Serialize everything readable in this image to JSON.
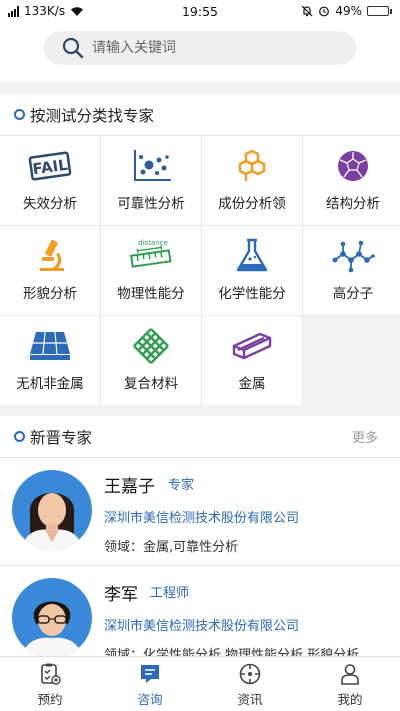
{
  "status_bar": {
    "speed": "133K/s",
    "time": "19:55",
    "battery": "49%",
    "battery_level": 0.49
  },
  "search": {
    "placeholder": "请输入关键词"
  },
  "categories": {
    "title": "按测试分类找专家",
    "items": [
      {
        "label": "失效分析",
        "icon": "fail-stamp-icon"
      },
      {
        "label": "可靠性分析",
        "icon": "scatter-chart-icon"
      },
      {
        "label": "成份分析领",
        "icon": "molecule-hexagon-icon"
      },
      {
        "label": "结构分析",
        "icon": "fullerene-icon"
      },
      {
        "label": "形貌分析",
        "icon": "microscope-icon"
      },
      {
        "label": "物理性能分",
        "icon": "distance-ruler-icon",
        "icon_text": "distance"
      },
      {
        "label": "化学性能分",
        "icon": "flask-icon"
      },
      {
        "label": "高分子",
        "icon": "polymer-chain-icon"
      },
      {
        "label": "无机非金属",
        "icon": "solar-panel-icon"
      },
      {
        "label": "复合材料",
        "icon": "woven-fiber-icon"
      },
      {
        "label": "金属",
        "icon": "metal-beam-icon"
      }
    ]
  },
  "experts": {
    "title": "新晋专家",
    "more": "更多",
    "items": [
      {
        "name": "王嘉子",
        "title": "专家",
        "company": "深圳市美信检测技术股份有限公司",
        "field": "领域：金属,可靠性分析"
      },
      {
        "name": "李军",
        "title": "工程师",
        "company": "深圳市美信检测技术股份有限公司",
        "field": "领域：化学性能分析,物理性能分析,形貌分析"
      }
    ]
  },
  "tabbar": {
    "items": [
      {
        "label": "预约",
        "icon": "clipboard-icon"
      },
      {
        "label": "咨询",
        "icon": "chat-icon",
        "active": true
      },
      {
        "label": "资讯",
        "icon": "compass-icon"
      },
      {
        "label": "我的",
        "icon": "person-icon"
      }
    ]
  },
  "colors": {
    "accent": "#2b6ab8",
    "orange": "#f39c1f",
    "green": "#2e9e4f",
    "purple": "#7b3fa0"
  }
}
